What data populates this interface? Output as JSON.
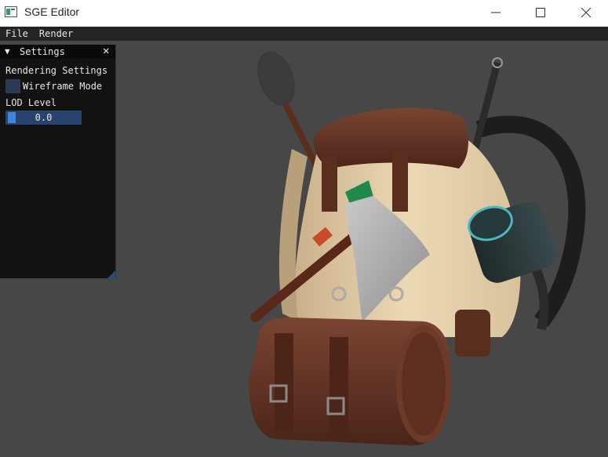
{
  "window": {
    "title": "SGE Editor",
    "controls": [
      "minimize",
      "maximize",
      "close"
    ]
  },
  "menubar": {
    "items": [
      "File",
      "Render"
    ]
  },
  "settings_panel": {
    "title": "Settings",
    "section_label": "Rendering Settings",
    "wireframe_label": "Wireframe Mode",
    "wireframe_checked": false,
    "lod_label": "LOD Level",
    "lod_value": "0.0",
    "lod_fraction": 0.0
  },
  "colors": {
    "viewport_bg": "#474747",
    "menubar_bg": "#242424",
    "panel_bg": "#0f0f0f",
    "accent": "#3d85e0",
    "checkbox_bg": "#2a3a55"
  },
  "icons": {
    "app": "app-icon",
    "collapse": "collapse-triangle-icon",
    "close": "close-icon"
  }
}
